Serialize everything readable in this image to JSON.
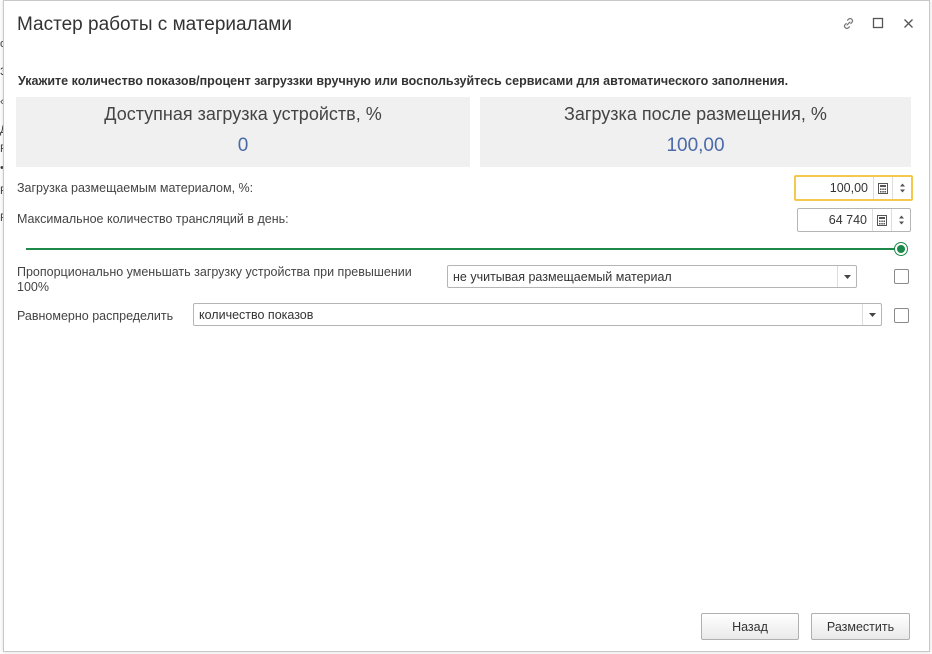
{
  "background_window": {
    "edge_chars": [
      "о",
      "З",
      "«",
      "Д",
      "Р",
      "•",
      "Р",
      "Р"
    ]
  },
  "dialog": {
    "title": "Мастер работы с материалами",
    "icons": [
      "link-icon",
      "maximize-icon",
      "close-icon"
    ]
  },
  "instruction": "Укажите количество показов/процент загруззки вручную или воспользуйтесь сервисами для автоматического заполнения.",
  "panels": {
    "available": {
      "title": "Доступная загрузка устройств, %",
      "value": "0"
    },
    "after": {
      "title": "Загрузка после размещения, %",
      "value": "100,00"
    }
  },
  "fields": {
    "load_material": {
      "label": "Загрузка размещаемым материалом, %:",
      "value": "100,00"
    },
    "max_broadcasts": {
      "label": "Максимальное количество трансляций в день:",
      "value": "64 740"
    }
  },
  "slider": {
    "level_fraction": 1.0
  },
  "options": {
    "proportional": {
      "label": "Пропорционально уменьшать загрузку устройства при превышении 100%",
      "select_value": "не учитывая размещаемый материал",
      "checked": false
    },
    "distribute": {
      "label": "Равномерно распределить",
      "select_value": "количество показов",
      "checked": false
    }
  },
  "buttons": {
    "back": "Назад",
    "place": "Разместить"
  },
  "colors": {
    "accent_green": "#1e8a4a",
    "value_blue": "#4a6aa8",
    "focus_yellow": "#f2c94c"
  }
}
